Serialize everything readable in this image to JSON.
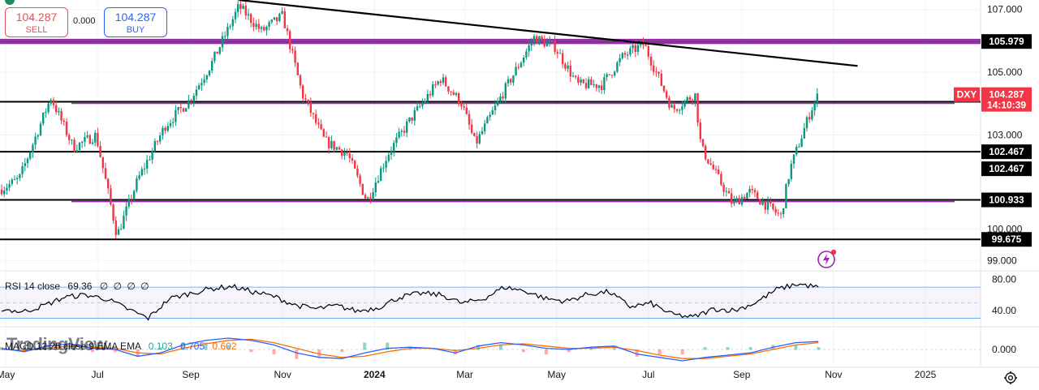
{
  "trade_panel": {
    "sell_price": "104.287",
    "sell_label": "SELL",
    "spread": "0.000",
    "buy_price": "104.287",
    "buy_label": "BUY"
  },
  "watermark": "TradingView",
  "colors": {
    "up": "#089981",
    "down": "#f23645",
    "purple": "#9c27b0",
    "rsi_line": "#000000",
    "macd_line": "#2962ff",
    "signal_line": "#ff6d00",
    "last_price_tag": "#f23645"
  },
  "chart_data": [
    {
      "type": "candlestick",
      "symbol": "DXY",
      "x_ticks": [
        "May",
        "Jul",
        "Sep",
        "Nov",
        "2024",
        "Mar",
        "May",
        "Jul",
        "Sep",
        "Nov",
        "2025"
      ],
      "y_ticks": [
        99.0,
        100.0,
        103.0,
        105.0,
        107.0
      ],
      "y_tick_labels": [
        "99.000",
        "100.000",
        "103.000",
        "105.000",
        "107.000"
      ],
      "ylim": [
        98.7,
        107.3
      ],
      "last_price": "104.287",
      "countdown": "14:10:39",
      "close_path": [
        [
          "2023-04-10",
          101.5
        ],
        [
          "2023-04-25",
          101.2
        ],
        [
          "2023-05-10",
          101.6
        ],
        [
          "2023-05-31",
          104.2
        ],
        [
          "2023-06-15",
          102.6
        ],
        [
          "2023-06-30",
          103.0
        ],
        [
          "2023-07-14",
          99.8
        ],
        [
          "2023-07-28",
          101.6
        ],
        [
          "2023-08-15",
          103.3
        ],
        [
          "2023-08-31",
          104.1
        ],
        [
          "2023-09-15",
          105.3
        ],
        [
          "2023-10-03",
          107.1
        ],
        [
          "2023-10-18",
          106.3
        ],
        [
          "2023-11-01",
          106.8
        ],
        [
          "2023-11-14",
          104.3
        ],
        [
          "2023-11-29",
          102.8
        ],
        [
          "2023-12-14",
          102.4
        ],
        [
          "2023-12-27",
          100.9
        ],
        [
          "2024-01-10",
          102.4
        ],
        [
          "2024-01-25",
          103.5
        ],
        [
          "2024-02-14",
          104.8
        ],
        [
          "2024-02-28",
          104.0
        ],
        [
          "2024-03-08",
          102.7
        ],
        [
          "2024-03-26",
          104.3
        ],
        [
          "2024-04-16",
          106.1
        ],
        [
          "2024-04-30",
          105.8
        ],
        [
          "2024-05-15",
          104.6
        ],
        [
          "2024-05-31",
          104.6
        ],
        [
          "2024-06-14",
          105.5
        ],
        [
          "2024-06-28",
          105.9
        ],
        [
          "2024-07-17",
          103.8
        ],
        [
          "2024-08-01",
          104.3
        ],
        [
          "2024-08-05",
          102.6
        ],
        [
          "2024-08-26",
          100.8
        ],
        [
          "2024-09-06",
          101.2
        ],
        [
          "2024-09-27",
          100.4
        ],
        [
          "2024-10-03",
          101.9
        ],
        [
          "2024-10-17",
          103.8
        ],
        [
          "2024-10-22",
          104.287
        ]
      ],
      "horizontal_levels": [
        {
          "value": 105.979,
          "label": "105.979",
          "color": "#9c27b0"
        },
        {
          "value": 104.059,
          "label": "104.059",
          "color": "#000000"
        },
        {
          "value": 102.467,
          "label": "102.467",
          "color": "#000000"
        },
        {
          "value": 102.467,
          "label": "102.467",
          "color": "#000000"
        },
        {
          "value": 100.933,
          "label": "100.933",
          "color": "#000000"
        },
        {
          "value": 99.675,
          "label": "99.675",
          "color": "#000000"
        }
      ],
      "trendline": {
        "from": [
          "2023-10-03",
          107.3
        ],
        "to": [
          "2024-11-17",
          105.2
        ]
      }
    },
    {
      "type": "line",
      "title": "RSI 14 close",
      "value": "69.36",
      "placeholders": [
        "∅",
        "∅",
        "∅",
        "∅"
      ],
      "y_ticks": [
        "80.00",
        "40.00"
      ],
      "ylim": [
        20,
        90
      ],
      "series": [
        {
          "name": "RSI",
          "values": [
            42,
            38,
            46,
            57,
            60,
            55,
            42,
            30,
            55,
            62,
            68,
            71,
            64,
            58,
            47,
            42,
            46,
            39,
            44,
            57,
            62,
            60,
            49,
            55,
            70,
            65,
            55,
            52,
            61,
            64,
            45,
            49,
            35,
            31,
            42,
            40,
            50,
            67,
            74,
            70
          ]
        }
      ]
    },
    {
      "type": "line",
      "title": "MACD 12 26 close 9 EMA EMA",
      "values_text": [
        "0.103",
        "0.705",
        "0.602"
      ],
      "y_ticks": [
        "0.000"
      ],
      "series": [
        {
          "name": "MACD",
          "values": [
            0.1,
            -0.2,
            0.3,
            0.5,
            0.1,
            0.0,
            -0.6,
            -0.3,
            0.4,
            0.8,
            1.0,
            0.8,
            0.4,
            -0.3,
            -0.7,
            -0.8,
            -0.3,
            0.1,
            0.2,
            0.1,
            -0.3,
            0.3,
            0.6,
            0.4,
            0.1,
            0.0,
            0.2,
            0.3,
            -0.4,
            -0.7,
            -1.0,
            -0.7,
            -0.5,
            -0.3,
            0.2,
            0.6,
            0.7
          ]
        },
        {
          "name": "Signal",
          "values": [
            0.0,
            -0.1,
            0.1,
            0.3,
            0.2,
            0.1,
            -0.3,
            -0.4,
            0.1,
            0.5,
            0.8,
            0.9,
            0.6,
            0.1,
            -0.4,
            -0.7,
            -0.6,
            -0.2,
            0.1,
            0.1,
            -0.1,
            0.1,
            0.4,
            0.5,
            0.3,
            0.1,
            0.1,
            0.2,
            -0.1,
            -0.5,
            -0.8,
            -0.8,
            -0.6,
            -0.4,
            0.0,
            0.4,
            0.6
          ]
        }
      ]
    }
  ]
}
